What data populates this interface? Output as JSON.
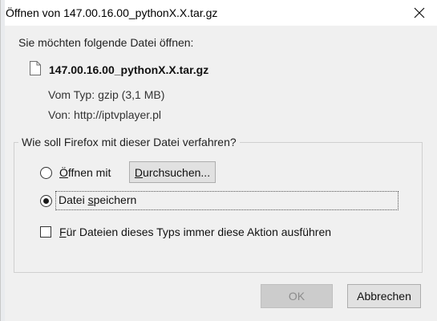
{
  "window": {
    "title": "Öffnen von 147.00.16.00_pythonX.X.tar.gz"
  },
  "dialog": {
    "prompt": "Sie möchten folgende Datei öffnen:",
    "file_name": "147.00.16.00_pythonX.X.tar.gz",
    "type_label": "Vom Typ:",
    "type_value": "gzip (3,1 MB)",
    "source_label": "Von:",
    "source_value": "http://iptvplayer.pl"
  },
  "action_group": {
    "legend": "Wie soll Firefox mit dieser Datei verfahren?",
    "open_with_label_pre": "",
    "open_with_accel": "Ö",
    "open_with_label_post": "ffnen mit",
    "browse_accel": "D",
    "browse_label_post": "urchsuchen...",
    "save_label_pre": "Datei ",
    "save_accel": "s",
    "save_label_post": "peichern",
    "selected": "save",
    "always_accel": "F",
    "always_label_post": "ür Dateien dieses Typs immer diese Aktion ausführen",
    "always_checked": false
  },
  "buttons": {
    "ok_label": "OK",
    "ok_enabled": false,
    "cancel_label": "Abbrechen"
  },
  "icons": {
    "close": "close-icon",
    "file": "file-icon"
  }
}
